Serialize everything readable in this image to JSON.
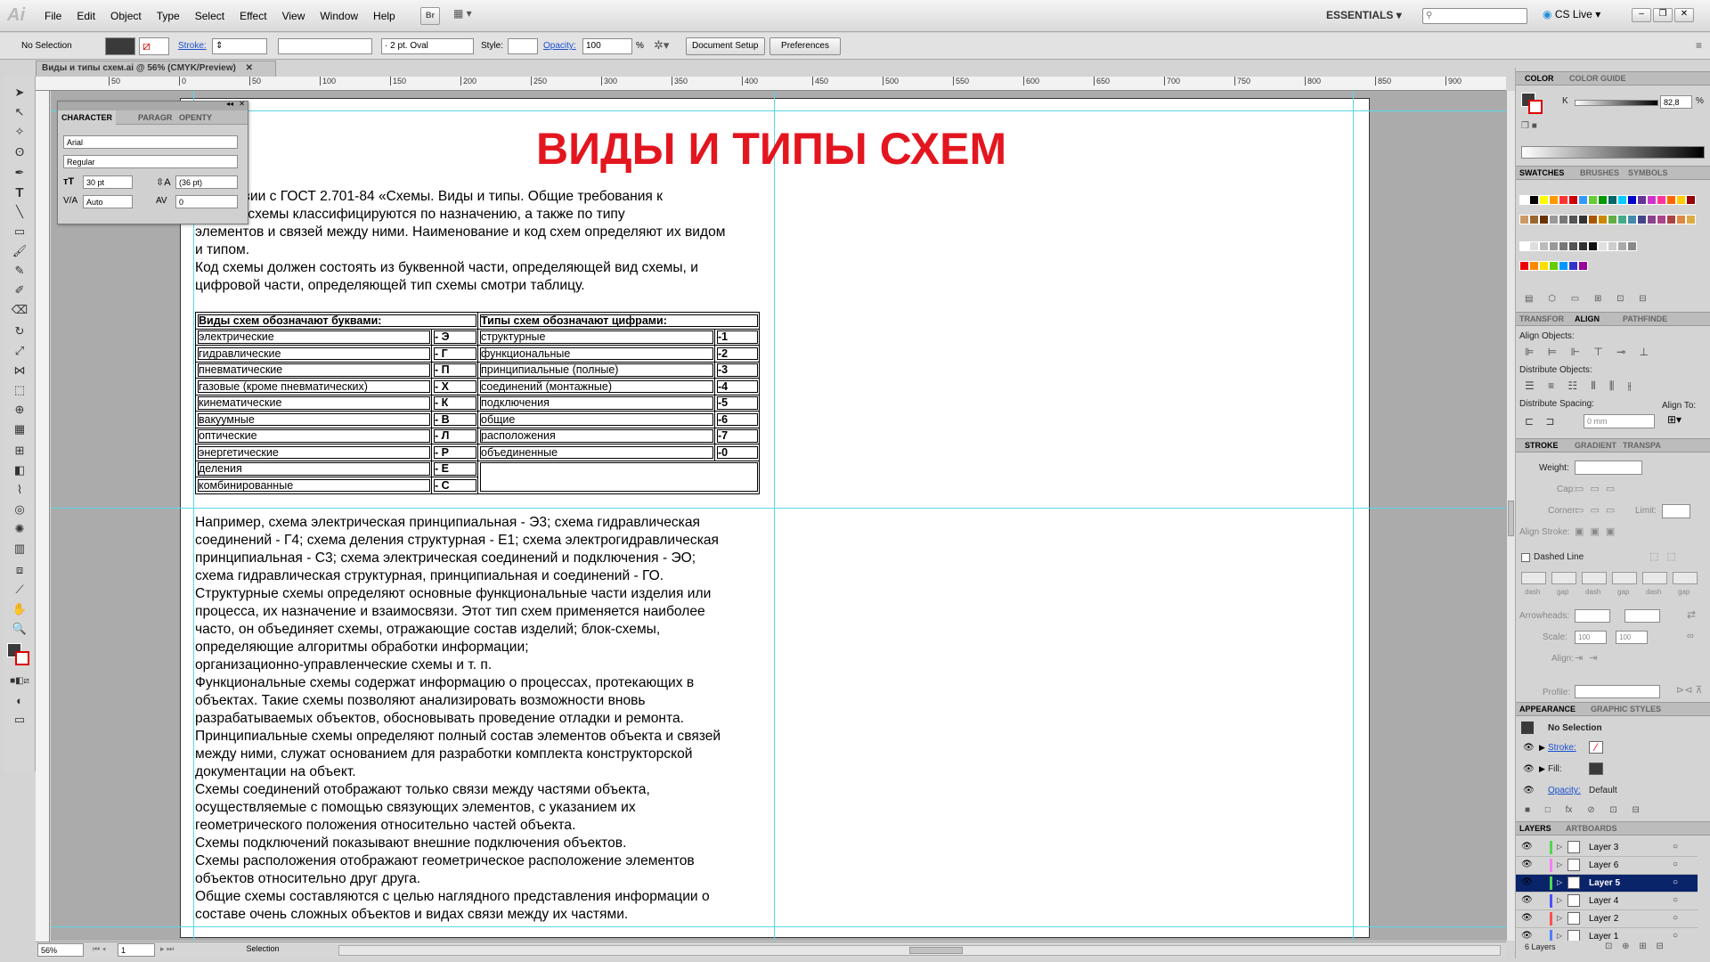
{
  "app": {
    "logo": "Ai"
  },
  "menubar": {
    "items": [
      "File",
      "Edit",
      "Object",
      "Type",
      "Select",
      "Effect",
      "View",
      "Window",
      "Help"
    ],
    "workspace": "ESSENTIALS",
    "search_placeholder": "",
    "cslive": "CS Live"
  },
  "control_bar": {
    "selection": "No Selection",
    "stroke_label": "Stroke:",
    "brush": "2 pt. Oval",
    "style_label": "Style:",
    "opacity_label": "Opacity:",
    "opacity_value": "100",
    "opacity_unit": "%",
    "document_setup": "Document Setup",
    "preferences": "Preferences"
  },
  "document_tab": {
    "title": "Виды и типы схем.ai @ 56% (CMYK/Preview)"
  },
  "ruler": {
    "h_ticks": [
      "50",
      "0",
      "50",
      "100",
      "150",
      "200",
      "250",
      "300",
      "350",
      "400",
      "450",
      "500",
      "550",
      "600",
      "650",
      "700",
      "750",
      "800",
      "850",
      "900"
    ]
  },
  "character_panel": {
    "tabs": [
      "CHARACTER",
      "PARAGR",
      "OPENTY"
    ],
    "font": "Arial",
    "style": "Regular",
    "size": "30 pt",
    "leading": "(36 pt)",
    "kerning": "Auto",
    "tracking": "0"
  },
  "document": {
    "title": "ВИДЫ И ТИПЫ СХЕМ",
    "intro_lines": [
      "ответствии с ГОСТ 2.701-84 «Схемы. Виды и типы. Общие требования к",
      "нению» схемы классифицируются по назначению, а также по типу",
      "элементов и связей между ними. Наименование и код схем определяют их видом",
      "и типом.",
      "Код схемы должен состоять из буквенной части, определяющей вид схемы, и",
      "цифровой части, определяющей тип схемы смотри таблицу."
    ],
    "table": {
      "headers": [
        "Виды схем обозначают буквами:",
        "Типы схем обозначают цифрами:"
      ],
      "rows": [
        [
          "электрические",
          "- Э",
          "структурные",
          "-1"
        ],
        [
          "гидравлические",
          "- Г",
          "функциональные",
          "-2"
        ],
        [
          "пневматические",
          "- П",
          "принципиальные (полные)",
          "-3"
        ],
        [
          "газовые (кроме пневматических)",
          "- Х",
          "соединений (монтажные)",
          "-4"
        ],
        [
          "кинематические",
          "- К",
          "подключения",
          "-5"
        ],
        [
          "вакуумные",
          "- В",
          "общие",
          "-6"
        ],
        [
          "оптические",
          "- Л",
          "расположения",
          "-7"
        ],
        [
          "энергетические",
          "- Р",
          "объединенные",
          "-0"
        ],
        [
          "деления",
          "- Е",
          "",
          ""
        ],
        [
          "комбинированные",
          "- С",
          "",
          ""
        ]
      ]
    },
    "body_lines": [
      "Например, схема электрическая принципиальная - Э3; схема гидравлическая",
      "соединений - Г4; схема деления структурная - Е1; схема электрогидравлическая",
      "принципиальная - С3; схема электрическая соединений и подключения - ЭО;",
      "схема гидравлическая структурная, принципиальная и соединений - ГО.",
      "Структурные схемы определяют основные функциональные части изделия или",
      "процесса, их назначение и взаимосвязи. Этот тип схем применяется наиболее",
      "часто, он объединяет схемы, отражающие состав изделий; блок-схемы,",
      "определяющие алгоритмы обработки информации;",
      "организационно-управленческие схемы и т. п.",
      "Функциональные схемы содержат информацию о процессах, протекающих в",
      "объектах. Такие схемы позволяют анализировать возможности вновь",
      "разрабатываемых объектов, обосновывать проведение отладки и ремонта.",
      "Принципиальные схемы определяют полный состав элементов объекта и связей",
      "между ними, служат основанием для разработки комплекта конструкторской",
      "документации на объект.",
      "Схемы соединений отображают только связи между частями объекта,",
      "осуществляемые с помощью связующих элементов, с указанием их",
      "геометрического положения относительно частей объекта.",
      "Схемы подключений показывают внешние подключения объектов.",
      "Схемы расположения отображают геометрическое расположение элементов",
      "объектов относительно друг друга.",
      "Общие схемы составляются с целью наглядного представления информации о",
      "составе очень сложных объектов и видах связи между их частями."
    ]
  },
  "color_panel": {
    "tabs": [
      "COLOR",
      "COLOR GUIDE"
    ],
    "channel": "K",
    "value": "82,8",
    "unit": "%"
  },
  "swatches_panel": {
    "tabs": [
      "SWATCHES",
      "BRUSHES",
      "SYMBOLS"
    ]
  },
  "align_panel": {
    "tabs": [
      "TRANSFOR",
      "ALIGN",
      "PATHFINDE"
    ],
    "align_objects": "Align Objects:",
    "distribute_objects": "Distribute Objects:",
    "distribute_spacing": "Distribute Spacing:",
    "align_to": "Align To:",
    "spacing_value": "0 mm"
  },
  "stroke_panel": {
    "tabs": [
      "STROKE",
      "GRADIENT",
      "TRANSPA"
    ],
    "weight": "Weight:",
    "cap": "Cap:",
    "corner": "Corner:",
    "limit": "Limit:",
    "align_stroke": "Align Stroke:",
    "dashed_line": "Dashed Line",
    "dash_labels": [
      "dash",
      "gap",
      "dash",
      "gap",
      "dash",
      "gap"
    ],
    "arrowheads": "Arrowheads:",
    "scale": "Scale:",
    "scale_values": [
      "100",
      "100"
    ],
    "align": "Align:",
    "profile": "Profile:"
  },
  "appearance_panel": {
    "tabs": [
      "APPEARANCE",
      "GRAPHIC STYLES"
    ],
    "selection": "No Selection",
    "stroke": "Stroke:",
    "fill": "Fill:",
    "opacity": "Opacity:",
    "opacity_value": "Default"
  },
  "layers_panel": {
    "tabs": [
      "LAYERS",
      "ARTBOARDS"
    ],
    "layers": [
      {
        "name": "Layer 3",
        "color": "#4fd84f"
      },
      {
        "name": "Layer 6",
        "color": "#f47ff4"
      },
      {
        "name": "Layer 5",
        "color": "#4fd84f",
        "selected": true
      },
      {
        "name": "Layer 4",
        "color": "#4f4fff"
      },
      {
        "name": "Layer 2",
        "color": "#ff4f4f"
      },
      {
        "name": "Layer 1",
        "color": "#4f7fff"
      }
    ],
    "count": "6 Layers"
  },
  "status_bar": {
    "zoom": "56%",
    "page": "1",
    "tool": "Selection"
  },
  "colors": {
    "title_red": "#e3161f",
    "guide": "#5ad8e6",
    "selected_layer": "#0a246a"
  }
}
